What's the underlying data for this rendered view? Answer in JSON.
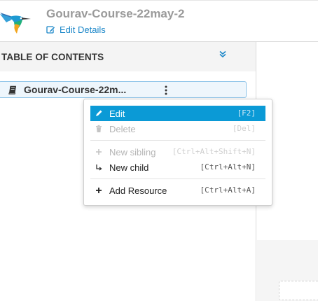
{
  "header": {
    "course_title": "Gourav-Course-22may-2",
    "edit_details_label": "Edit Details"
  },
  "toc": {
    "title": "TABLE OF CONTENTS",
    "collapse_icon": "double-chevron-down-icon",
    "item": {
      "label": "Gourav-Course-22m...",
      "icon": "book-icon"
    }
  },
  "context_menu": {
    "items": [
      {
        "label": "Edit",
        "shortcut": "[F2]",
        "icon": "pencil-icon",
        "state": "highlighted"
      },
      {
        "label": "Delete",
        "shortcut": "[Del]",
        "icon": "trash-icon",
        "state": "disabled"
      },
      {
        "label": "New sibling",
        "shortcut": "[Ctrl+Alt+Shift+N]",
        "icon": "plus-icon",
        "state": "disabled"
      },
      {
        "label": "New child",
        "shortcut": "[Ctrl+Alt+N]",
        "icon": "child-arrow-icon",
        "state": "enabled"
      },
      {
        "label": "Add Resource",
        "shortcut": "[Ctrl+Alt+A]",
        "icon": "plus-icon",
        "state": "enabled"
      }
    ]
  },
  "colors": {
    "accent": "#0b9ad6",
    "link": "#1a86c8",
    "selected_row_bg": "#eef6fc",
    "selected_row_border": "#8ec4e8"
  }
}
